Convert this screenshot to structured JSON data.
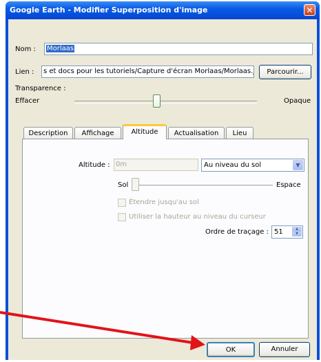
{
  "window": {
    "title": "Google Earth - Modifier Superposition d'image",
    "close_glyph": "✕"
  },
  "form": {
    "name_label": "Nom :",
    "name_value": "Morlaas",
    "link_label": "Lien :",
    "link_value": "s et docs pour les tutoriels/Capture d'écran Morlaas/Morlaas.jpg",
    "browse_label": "Parcourir...",
    "transparency_label": "Transparence :",
    "transparency_min": "Effacer",
    "transparency_max": "Opaque"
  },
  "tabs": [
    {
      "label": "Description"
    },
    {
      "label": "Affichage"
    },
    {
      "label": "Altitude"
    },
    {
      "label": "Actualisation"
    },
    {
      "label": "Lieu"
    }
  ],
  "altitude": {
    "label": "Altitude :",
    "placeholder": "0m",
    "mode": "Au niveau du sol",
    "slider_min": "Sol",
    "slider_max": "Espace",
    "extend_label": "Étendre jusqu'au sol",
    "cursor_height_label": "Utiliser la hauteur au niveau du curseur",
    "draw_order_label": "Ordre de traçage :",
    "draw_order_value": "51"
  },
  "buttons": {
    "ok": "OK",
    "cancel": "Annuler"
  },
  "colors": {
    "arrow": "#e0141a"
  }
}
